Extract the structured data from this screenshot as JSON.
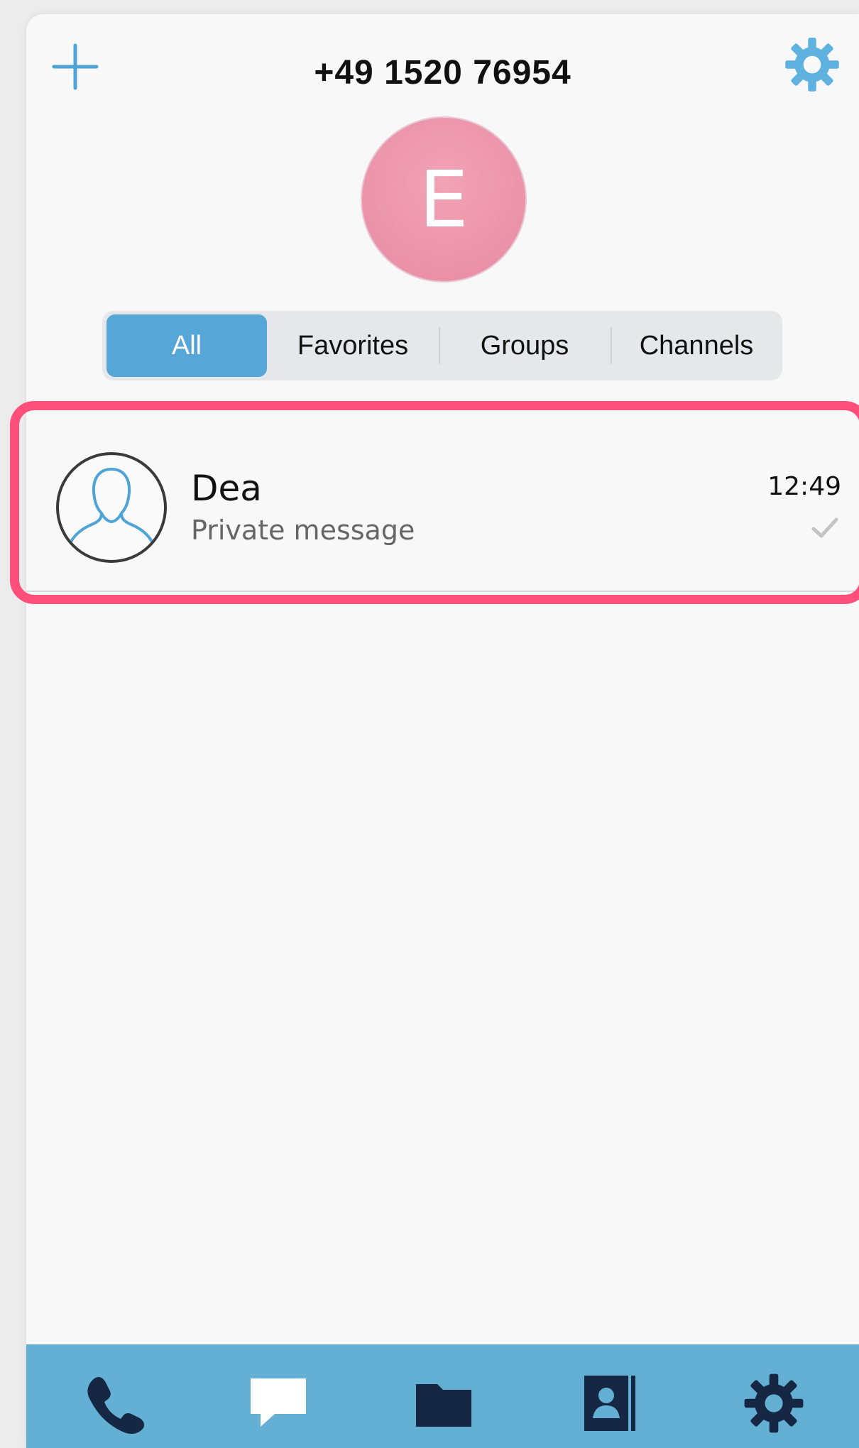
{
  "header": {
    "title": "+49 1520 76954",
    "add_icon": "plus-icon",
    "settings_icon": "gear-icon"
  },
  "profile": {
    "avatar_letter": "E",
    "avatar_color": "#ea91a8"
  },
  "filter_tabs": {
    "items": [
      {
        "label": "All",
        "active": true
      },
      {
        "label": "Favorites",
        "active": false
      },
      {
        "label": "Groups",
        "active": false
      },
      {
        "label": "Channels",
        "active": false
      }
    ],
    "accent": "#56a6d8"
  },
  "chats": [
    {
      "name": "Dea",
      "preview": "Private message",
      "time": "12:49",
      "status_icon": "checkmark-icon",
      "avatar_icon": "person-silhouette-icon"
    }
  ],
  "tabbar": {
    "icons": [
      "phone-icon",
      "chat-bubble-icon",
      "folder-icon",
      "contacts-icon",
      "gear-icon"
    ],
    "background": "#64b0d5"
  },
  "highlight_color": "#ff4f7a"
}
